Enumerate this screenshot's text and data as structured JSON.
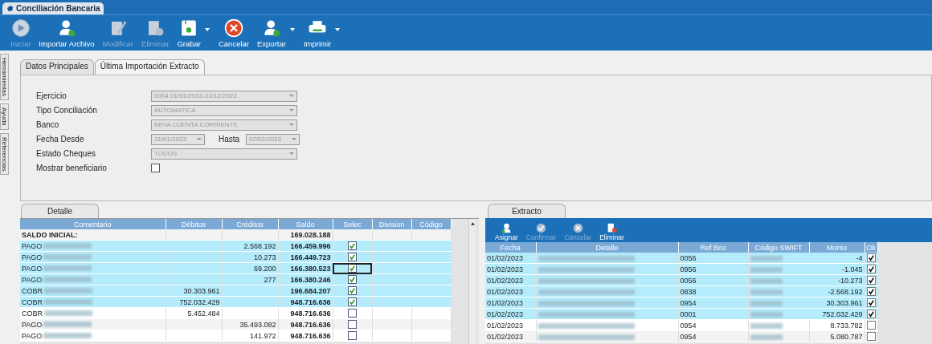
{
  "window": {
    "title": "Conciliación Bancaria"
  },
  "toolbar": [
    {
      "label": "Iniciar",
      "kind": "play",
      "disabled": true,
      "dropdown": false
    },
    {
      "label": "Importar Archivo",
      "kind": "user-add",
      "disabled": false,
      "dropdown": false
    },
    {
      "label": "Modificar",
      "kind": "edit",
      "disabled": true,
      "dropdown": false
    },
    {
      "label": "Eliminar",
      "kind": "doc-delete",
      "disabled": true,
      "dropdown": false
    },
    {
      "label": "Grabar",
      "kind": "save",
      "disabled": false,
      "dropdown": true
    },
    {
      "label": "Cancelar",
      "kind": "cancel",
      "disabled": false,
      "dropdown": false
    },
    {
      "label": "Exportar",
      "kind": "user-add",
      "disabled": false,
      "dropdown": true
    },
    {
      "label": "Imprimir",
      "kind": "print",
      "disabled": false,
      "dropdown": true
    }
  ],
  "side_tabs": [
    "Herramientas",
    "Ayuda",
    "Referencias"
  ],
  "tabs": [
    {
      "label": "Datos Principales",
      "selected": true
    },
    {
      "label": "Última Importación Extracto",
      "selected": false
    }
  ],
  "form": {
    "ejercicio": {
      "label": "Ejercicio",
      "value": "0004 01/01/2023-31/12/2023"
    },
    "tipo": {
      "label": "Tipo Conciliación",
      "value": "AUTOMATICA"
    },
    "banco": {
      "label": "Banco",
      "value": "BBVA CUENTA CORRIENTE"
    },
    "fecha_desde": {
      "label": "Fecha Desde",
      "value": "31/01/2023"
    },
    "hasta": {
      "label": "Hasta",
      "value": "02/02/2023"
    },
    "estado": {
      "label": "Estado Cheques",
      "value": "TODOS"
    },
    "mostrar": {
      "label": "Mostrar beneficiario",
      "checked": false
    }
  },
  "detalle": {
    "tab": "Detalle",
    "columns": [
      "Comentario",
      "Débitos",
      "Créditos",
      "Saldo",
      "Selec",
      "Division",
      "Código"
    ],
    "rows": [
      {
        "comentario": "SALDO INICIAL:",
        "debitos": "",
        "creditos": "",
        "saldo": "169.028.188",
        "kind": "total",
        "selected": false
      },
      {
        "comentario": "PAGO",
        "debitos": "",
        "creditos": "2.568.192",
        "saldo": "166.459.996",
        "kind": "item",
        "selected": true,
        "checked": true
      },
      {
        "comentario": "PAGO",
        "debitos": "",
        "creditos": "10.273",
        "saldo": "166.449.723",
        "kind": "item",
        "selected": true,
        "checked": true
      },
      {
        "comentario": "PAGO",
        "debitos": "",
        "creditos": "69.200",
        "saldo": "166.380.523",
        "kind": "item",
        "selected": true,
        "checked": true,
        "focused": true
      },
      {
        "comentario": "PAGO",
        "debitos": "",
        "creditos": "277",
        "saldo": "166.380.246",
        "kind": "item",
        "selected": true,
        "checked": true
      },
      {
        "comentario": "COBR",
        "debitos": "30.303.961",
        "creditos": "",
        "saldo": "196.684.207",
        "kind": "item",
        "selected": true,
        "checked": true
      },
      {
        "comentario": "COBR",
        "debitos": "752.032.429",
        "creditos": "",
        "saldo": "948.716.636",
        "kind": "item",
        "selected": true,
        "checked": true
      },
      {
        "comentario": "COBR",
        "debitos": "5.452.484",
        "creditos": "",
        "saldo": "948.716.636",
        "kind": "item",
        "selected": false,
        "checked": false
      },
      {
        "comentario": "PAGO",
        "debitos": "",
        "creditos": "35.493.082",
        "saldo": "948.716.636",
        "kind": "item",
        "selected": false,
        "checked": false
      },
      {
        "comentario": "PAGO",
        "debitos": "",
        "creditos": "141.972",
        "saldo": "948.716.636",
        "kind": "item",
        "selected": false,
        "checked": false
      }
    ]
  },
  "extracto": {
    "tab": "Extracto",
    "toolbar": [
      {
        "label": "Asignar",
        "kind": "user-add",
        "disabled": false
      },
      {
        "label": "Confirmar",
        "kind": "check",
        "disabled": true
      },
      {
        "label": "Cancelar",
        "kind": "cancel",
        "disabled": true
      },
      {
        "label": "Eliminar",
        "kind": "doc-delete",
        "disabled": false
      }
    ],
    "columns": [
      "Fecha",
      "Detalle",
      "Ref Bco",
      "Código SWIFT",
      "Monto",
      "Ok"
    ],
    "rows": [
      {
        "fecha": "01/02/2023",
        "ref": "0056",
        "monto": "-4",
        "selected": true,
        "ok": true
      },
      {
        "fecha": "01/02/2023",
        "ref": "0956",
        "monto": "-1.045",
        "selected": true,
        "ok": true
      },
      {
        "fecha": "01/02/2023",
        "ref": "0056",
        "monto": "-10.273",
        "selected": true,
        "ok": true
      },
      {
        "fecha": "01/02/2023",
        "ref": "0838",
        "monto": "-2.568.192",
        "selected": true,
        "ok": true
      },
      {
        "fecha": "01/02/2023",
        "ref": "0954",
        "monto": "30.303.961",
        "selected": true,
        "ok": true
      },
      {
        "fecha": "01/02/2023",
        "ref": "0001",
        "monto": "752.032.429",
        "selected": true,
        "ok": true
      },
      {
        "fecha": "01/02/2023",
        "ref": "0954",
        "monto": "8.733.782",
        "selected": false,
        "ok": false
      },
      {
        "fecha": "01/02/2023",
        "ref": "0954",
        "monto": "5.080.787",
        "selected": false,
        "ok": false
      }
    ]
  }
}
